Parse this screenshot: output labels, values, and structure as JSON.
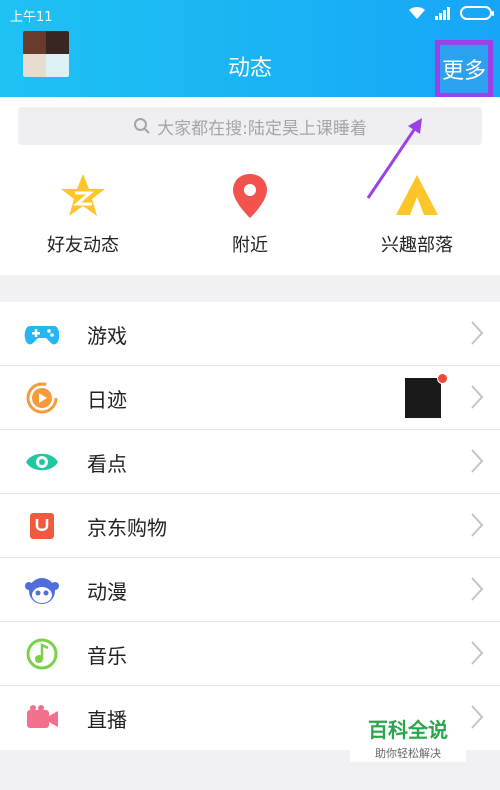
{
  "status_bar": {
    "time": "上午11"
  },
  "header": {
    "title": "动态",
    "more_label": "更多"
  },
  "search": {
    "placeholder": "大家都在搜:陆定昊上课睡着"
  },
  "quick_entries": [
    {
      "label": "好友动态",
      "icon": "qzone-star-icon",
      "color": "#fcc62b"
    },
    {
      "label": "附近",
      "icon": "location-pin-icon",
      "color": "#f4534d"
    },
    {
      "label": "兴趣部落",
      "icon": "tent-icon",
      "color": "#fcc62b"
    }
  ],
  "menu": [
    {
      "label": "游戏",
      "icon": "gamepad-icon",
      "color": "#25b7f0"
    },
    {
      "label": "日迹",
      "icon": "play-circle-icon",
      "color": "#f79a3b"
    },
    {
      "label": "看点",
      "icon": "eye-icon",
      "color": "#1ec7a0"
    },
    {
      "label": "京东购物",
      "icon": "jd-bag-icon",
      "color": "#f05a3f"
    },
    {
      "label": "动漫",
      "icon": "anime-face-icon",
      "color": "#4f6ed9"
    },
    {
      "label": "音乐",
      "icon": "music-note-icon",
      "color": "#7ccf48"
    },
    {
      "label": "直播",
      "icon": "video-camera-icon",
      "color": "#f36f8e"
    }
  ],
  "watermark": {
    "title": "百科全说",
    "subtitle": "助你轻松解决"
  }
}
